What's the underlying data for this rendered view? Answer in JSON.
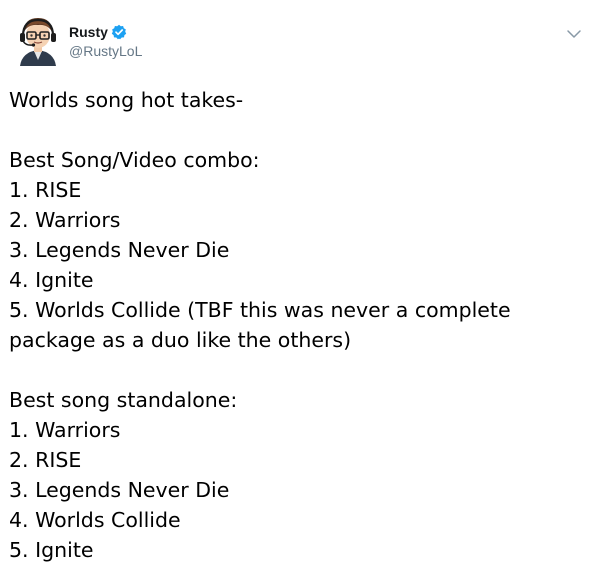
{
  "author": {
    "display_name": "Rusty",
    "handle": "@RustyLoL",
    "verified": true
  },
  "icons": {
    "verified": "verified-badge-icon",
    "menu": "chevron-down-icon"
  },
  "colors": {
    "verified_blue": "#1da1f2",
    "handle_gray": "#657786",
    "text": "#000000"
  },
  "tweet": {
    "intro": "Worlds song hot takes-",
    "combo_heading": "Best Song/Video combo:",
    "combo_items": [
      "1. RISE",
      "2. Warriors",
      "3. Legends Never Die",
      "4. Ignite",
      "5. Worlds Collide (TBF this was never a complete",
      "package as a duo like the others)"
    ],
    "standalone_heading": "Best song standalone:",
    "standalone_items": [
      "1. Warriors",
      "2. RISE",
      "3. Legends Never Die",
      "4. Worlds Collide",
      "5. Ignite"
    ]
  }
}
